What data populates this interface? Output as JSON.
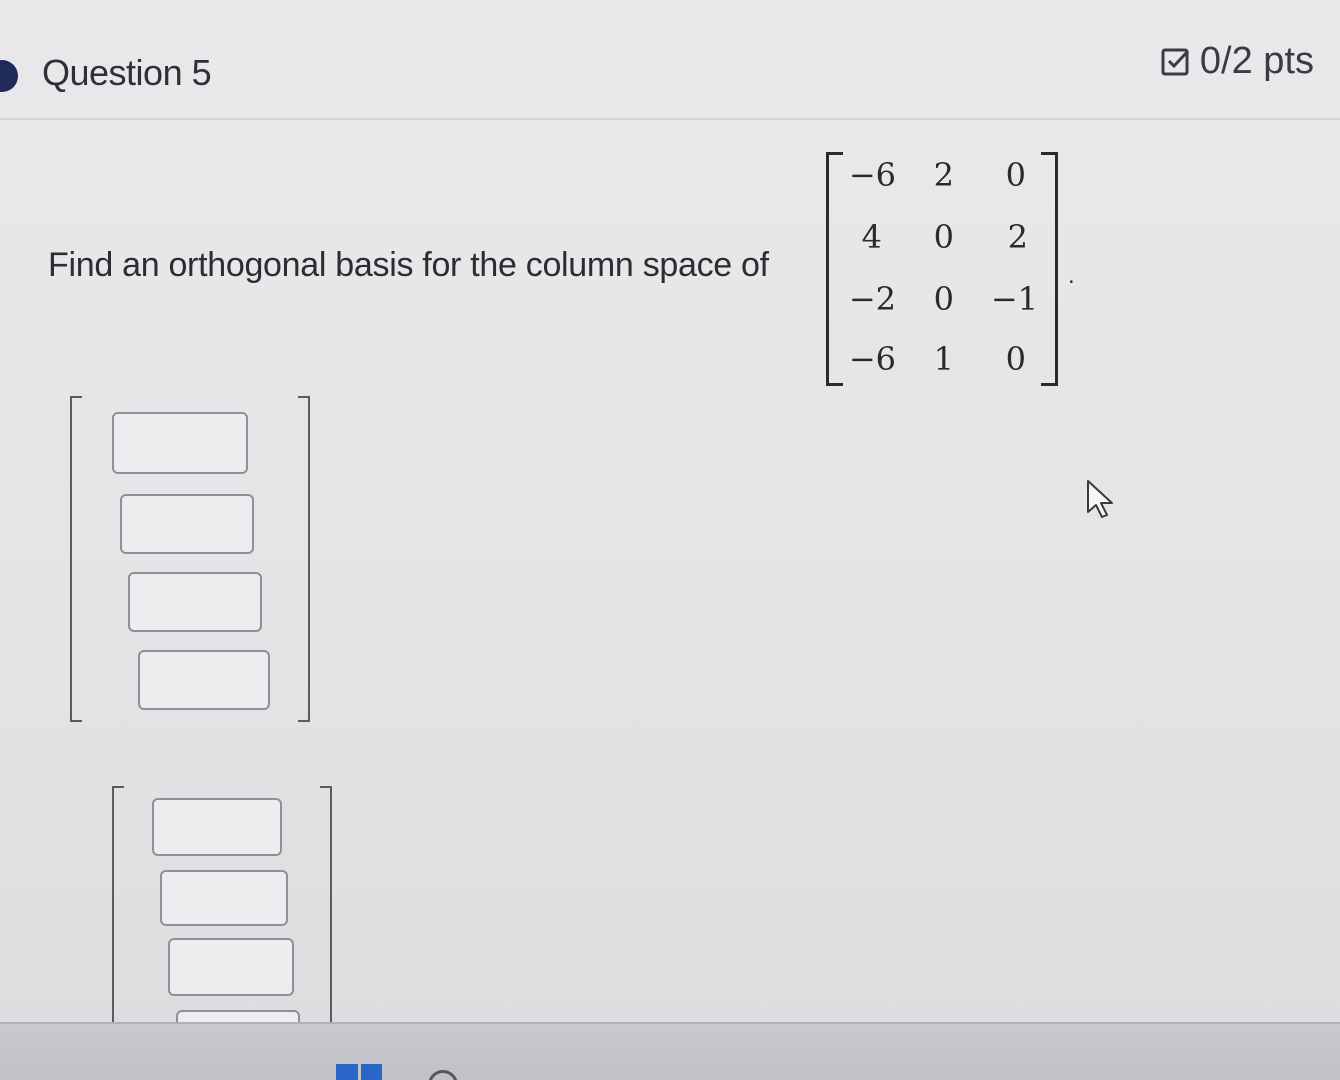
{
  "question": {
    "title": "Question 5",
    "points": "0/2 pts",
    "points_icon": "checkbox-edit-icon",
    "prompt": "Find an orthogonal basis for the column space of",
    "matrix": [
      [
        "−6",
        "2",
        "0"
      ],
      [
        "4",
        "0",
        "2"
      ],
      [
        "−2",
        "0",
        "−1"
      ],
      [
        "−6",
        "1",
        "0"
      ]
    ],
    "trailing_punct": "."
  },
  "answers": {
    "vectors": [
      {
        "entries": [
          "",
          "",
          "",
          ""
        ]
      },
      {
        "entries": [
          "",
          "",
          "",
          ""
        ]
      }
    ]
  },
  "colors": {
    "accent_dot": "#1f2a5a",
    "windows_blue": "#2a66c8"
  }
}
